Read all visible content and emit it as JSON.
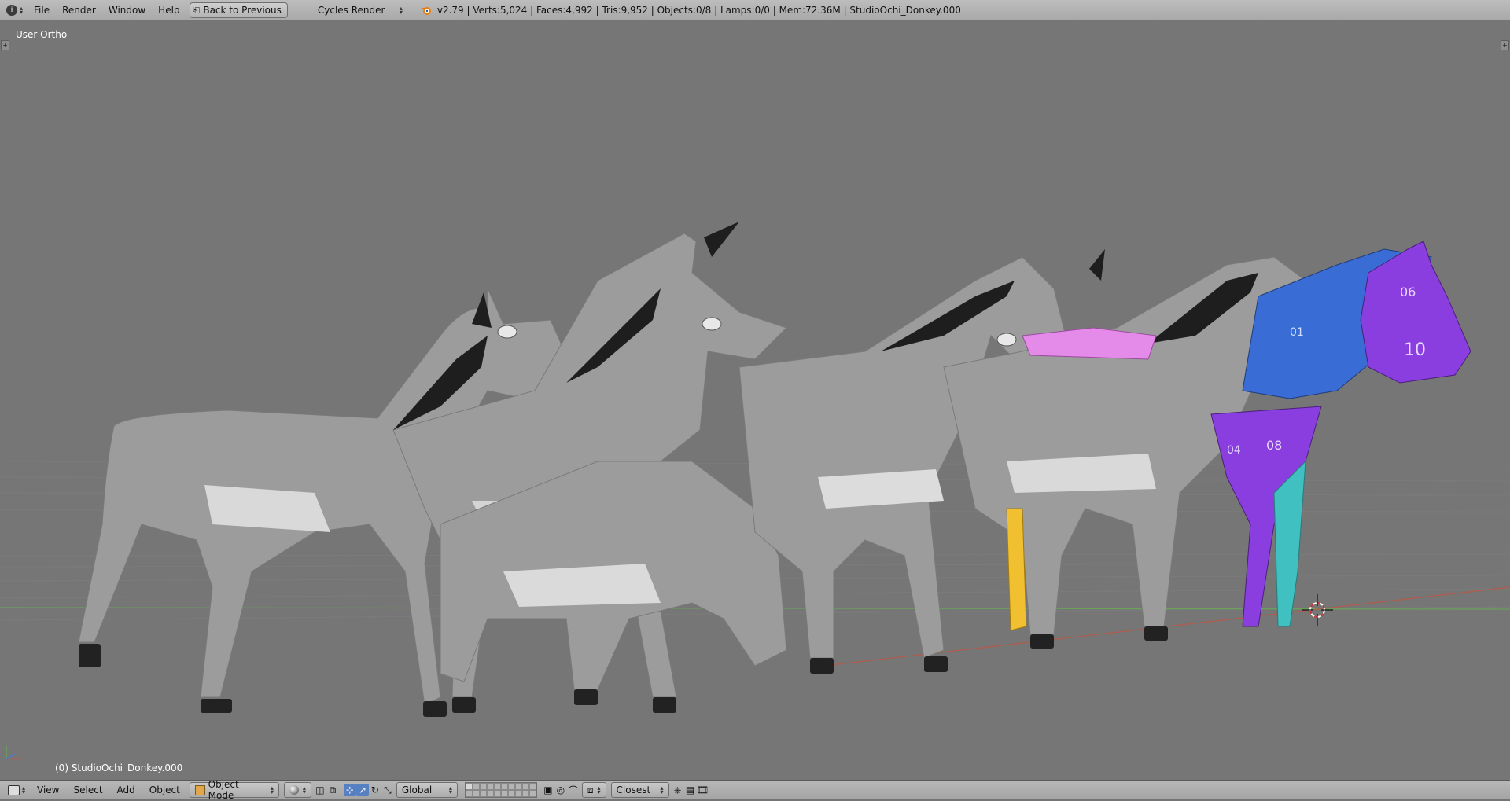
{
  "topbar": {
    "info_icon": "info-icon",
    "menus": [
      "File",
      "Render",
      "Window",
      "Help"
    ],
    "back_button": "Back to Previous",
    "render_engine": "Cycles Render",
    "blender_icon": "blender-icon",
    "stats": "v2.79 | Verts:5,024 | Faces:4,992 | Tris:9,952 | Objects:0/8 | Lamps:0/0 | Mem:72.36M | StudioOchi_Donkey.000"
  },
  "viewport": {
    "view_label": "User Ortho",
    "object_label": "(0) StudioOchi_Donkey.000",
    "grid_color": "#7a7a7a",
    "x_axis_color": "#b35a4a",
    "y_axis_color": "#6aa35a",
    "model_main_color": "#9c9c9c",
    "uv_colors": [
      "#8a3ee0",
      "#3a6cd6",
      "#e48ae8",
      "#f0c030",
      "#40c0c0"
    ],
    "uv_numbers": [
      "06",
      "10",
      "08",
      "04",
      "01"
    ]
  },
  "bottombar": {
    "editor_icon": "3d-view-icon",
    "menus": [
      "View",
      "Select",
      "Add",
      "Object"
    ],
    "mode": "Object Mode",
    "orientation": "Global",
    "snap_target": "Closest",
    "accent_color": "#5680c2"
  }
}
